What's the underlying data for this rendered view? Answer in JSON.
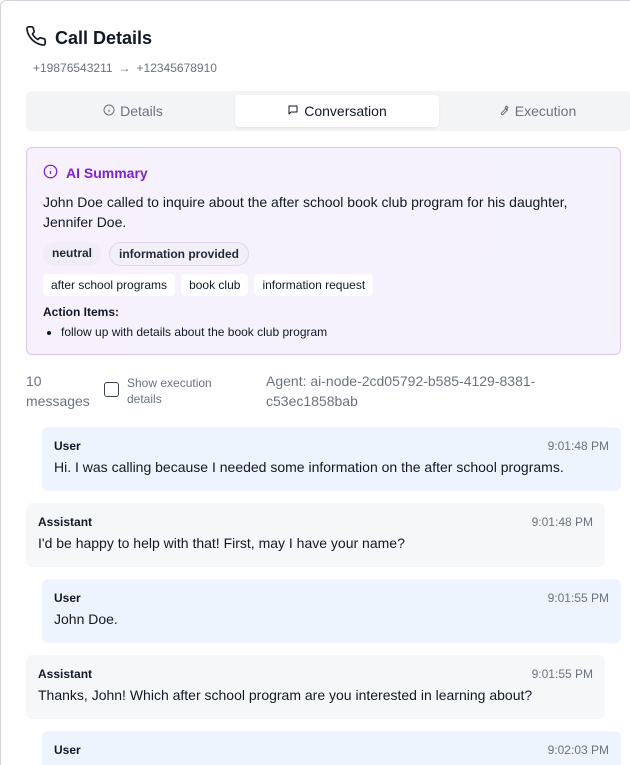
{
  "header": {
    "title": "Call Details",
    "from_number": "+19876543211",
    "arrow": "→",
    "to_number": "+12345678910"
  },
  "tabs": [
    {
      "label": "Details",
      "icon": "info-icon",
      "active": false
    },
    {
      "label": "Conversation",
      "icon": "message-icon",
      "active": true
    },
    {
      "label": "Execution",
      "icon": "wrench-icon",
      "active": false
    }
  ],
  "summary": {
    "heading": "AI Summary",
    "text": "John Doe called to inquire about the after school book club program for his daughter, Jennifer Doe.",
    "sentiment_badge": "neutral",
    "outcome_badge": "information provided",
    "tags": [
      "after school programs",
      "book club",
      "information request"
    ],
    "action_items_label": "Action Items:",
    "action_items": [
      "follow up with details about the book club program"
    ]
  },
  "meta": {
    "message_count": "10 messages",
    "show_execution_label": "Show execution details",
    "agent": "Agent: ai-node-2cd05792-b585-4129-8381-c53ec1858bab"
  },
  "messages": [
    {
      "role": "User",
      "time": "9:01:48 PM",
      "text": "Hi. I was calling because I needed some information on the after school programs."
    },
    {
      "role": "Assistant",
      "time": "9:01:48 PM",
      "text": "I'd be happy to help with that! First, may I have your name?"
    },
    {
      "role": "User",
      "time": "9:01:55 PM",
      "text": "John Doe."
    },
    {
      "role": "Assistant",
      "time": "9:01:55 PM",
      "text": "Thanks, John! Which after school program are you interested in learning about?"
    },
    {
      "role": "User",
      "time": "9:02:03 PM",
      "text": ""
    }
  ],
  "colors": {
    "accent_purple": "#7e22ce",
    "user_bubble": "#eef4fe",
    "assistant_bubble": "#f6f7f9"
  }
}
